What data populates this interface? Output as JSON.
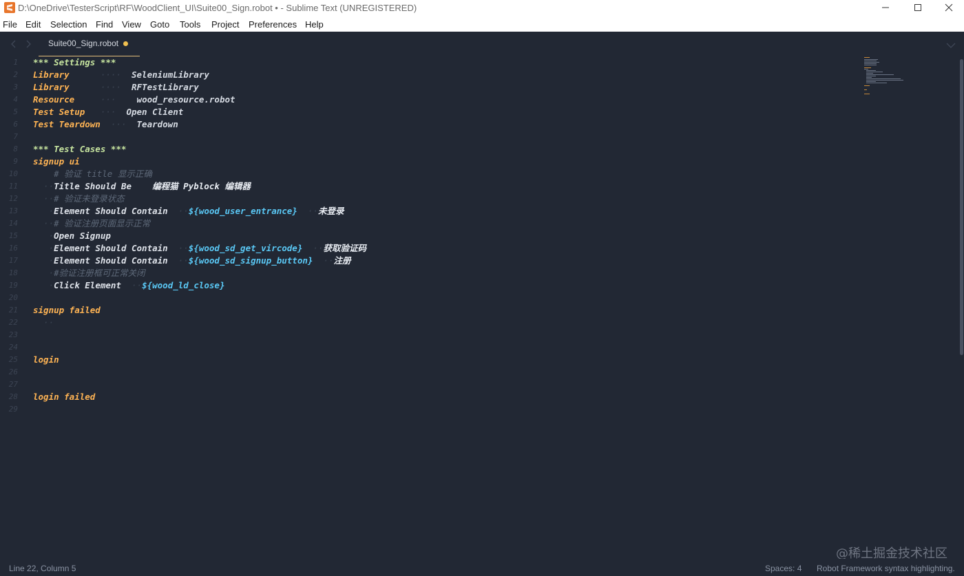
{
  "window": {
    "title": "D:\\OneDrive\\TesterScript\\RF\\WoodClient_UI\\Suite00_Sign.robot • - Sublime Text (UNREGISTERED)"
  },
  "menu": [
    "File",
    "Edit",
    "Selection",
    "Find",
    "View",
    "Goto",
    "Tools",
    "Project",
    "Preferences",
    "Help"
  ],
  "tab": {
    "label": "Suite00_Sign.robot",
    "dirty": true
  },
  "editor": {
    "line_numbers": [
      "1",
      "2",
      "3",
      "4",
      "5",
      "6",
      "7",
      "8",
      "9",
      "10",
      "11",
      "12",
      "13",
      "14",
      "15",
      "16",
      "17",
      "18",
      "19",
      "20",
      "21",
      "22",
      "23",
      "24",
      "25",
      "26",
      "27",
      "28",
      "29"
    ],
    "lines": [
      {
        "n": 1,
        "tokens": [
          {
            "t": "*** Settings ***",
            "c": "section"
          }
        ]
      },
      {
        "n": 2,
        "tokens": [
          {
            "t": "Library",
            "c": "setting"
          },
          {
            "t": "      ····  ",
            "c": "dots"
          },
          {
            "t": "SeleniumLibrary",
            "c": "value"
          }
        ]
      },
      {
        "n": 3,
        "tokens": [
          {
            "t": "Library",
            "c": "setting"
          },
          {
            "t": "      ····  ",
            "c": "dots"
          },
          {
            "t": "RFTestLibrary",
            "c": "value"
          }
        ]
      },
      {
        "n": 4,
        "tokens": [
          {
            "t": "Resource",
            "c": "setting"
          },
          {
            "t": "     ···   ",
            "c": "dots"
          },
          {
            "t": " wood_resource.robot",
            "c": "value"
          }
        ]
      },
      {
        "n": 5,
        "tokens": [
          {
            "t": "Test Setup",
            "c": "setting"
          },
          {
            "t": "   ···  ",
            "c": "dots"
          },
          {
            "t": "Open Client",
            "c": "value"
          }
        ]
      },
      {
        "n": 6,
        "tokens": [
          {
            "t": "Test Teardown",
            "c": "setting"
          },
          {
            "t": "  ···  ",
            "c": "dots"
          },
          {
            "t": "Teardown",
            "c": "value"
          }
        ]
      },
      {
        "n": 7,
        "tokens": []
      },
      {
        "n": 8,
        "tokens": [
          {
            "t": "*** Test Cases ***",
            "c": "section"
          }
        ]
      },
      {
        "n": 9,
        "tokens": [
          {
            "t": "signup ui",
            "c": "test"
          }
        ]
      },
      {
        "n": 10,
        "tokens": [
          {
            "t": "    # 验证 title 显示正确",
            "c": "comment"
          }
        ]
      },
      {
        "n": 11,
        "tokens": [
          {
            "t": "  ··",
            "c": "dots"
          },
          {
            "t": "Title Should Be",
            "c": "kw"
          },
          {
            "t": "    ",
            "c": "dots"
          },
          {
            "t": "编程猫 Pyblock 编辑器",
            "c": "cjk"
          }
        ]
      },
      {
        "n": 12,
        "tokens": [
          {
            "t": "  ··",
            "c": "dots"
          },
          {
            "t": "# 验证未登录状态",
            "c": "comment"
          }
        ]
      },
      {
        "n": 13,
        "tokens": [
          {
            "t": "   ·",
            "c": "dots"
          },
          {
            "t": "Element Should Contain",
            "c": "kw"
          },
          {
            "t": "  ··",
            "c": "dots"
          },
          {
            "t": "${wood_user_entrance}",
            "c": "var"
          },
          {
            "t": "  ··",
            "c": "dots"
          },
          {
            "t": "未登录",
            "c": "cjk"
          }
        ]
      },
      {
        "n": 14,
        "tokens": [
          {
            "t": "  ··",
            "c": "dots"
          },
          {
            "t": "# 验证注册页面显示正常",
            "c": "comment"
          }
        ]
      },
      {
        "n": 15,
        "tokens": [
          {
            "t": "   ·",
            "c": "dots"
          },
          {
            "t": "Open Signup",
            "c": "kw"
          }
        ]
      },
      {
        "n": 16,
        "tokens": [
          {
            "t": "   ·",
            "c": "dots"
          },
          {
            "t": "Element Should Contain",
            "c": "kw"
          },
          {
            "t": "  ··",
            "c": "dots"
          },
          {
            "t": "${wood_sd_get_vircode}",
            "c": "var"
          },
          {
            "t": "  ··",
            "c": "dots"
          },
          {
            "t": "获取验证码",
            "c": "cjk"
          }
        ]
      },
      {
        "n": 17,
        "tokens": [
          {
            "t": "   ·",
            "c": "dots"
          },
          {
            "t": "Element Should Contain",
            "c": "kw"
          },
          {
            "t": "  ··",
            "c": "dots"
          },
          {
            "t": "${wood_sd_signup_button}",
            "c": "var"
          },
          {
            "t": "  ··",
            "c": "dots"
          },
          {
            "t": "注册",
            "c": "cjk"
          }
        ]
      },
      {
        "n": 18,
        "tokens": [
          {
            "t": "   ·",
            "c": "dots"
          },
          {
            "t": "#验证注册框可正常关闭",
            "c": "comment"
          }
        ]
      },
      {
        "n": 19,
        "tokens": [
          {
            "t": "   ·",
            "c": "dots"
          },
          {
            "t": "Click Element",
            "c": "kw"
          },
          {
            "t": "  ··",
            "c": "dots"
          },
          {
            "t": "${wood_ld_close}",
            "c": "var"
          }
        ]
      },
      {
        "n": 20,
        "tokens": []
      },
      {
        "n": 21,
        "tokens": [
          {
            "t": "signup failed",
            "c": "test"
          }
        ]
      },
      {
        "n": 22,
        "tokens": [
          {
            "t": "  ··",
            "c": "dots"
          }
        ]
      },
      {
        "n": 23,
        "tokens": []
      },
      {
        "n": 24,
        "tokens": []
      },
      {
        "n": 25,
        "tokens": [
          {
            "t": "login",
            "c": "test"
          }
        ]
      },
      {
        "n": 26,
        "tokens": []
      },
      {
        "n": 27,
        "tokens": []
      },
      {
        "n": 28,
        "tokens": [
          {
            "t": "login failed",
            "c": "test"
          }
        ]
      },
      {
        "n": 29,
        "tokens": []
      }
    ]
  },
  "status": {
    "position": "Line 22, Column 5",
    "spaces": "Spaces: 4",
    "syntax": "Robot Framework syntax highlighting."
  },
  "watermark": "@稀土掘金技术社区",
  "colors": {
    "background": "#222834",
    "section": "#c8e6a0",
    "setting": "#ffb454",
    "variable": "#5ac8f5",
    "comment": "#5d6878",
    "dirty_dot": "#f0c050"
  }
}
